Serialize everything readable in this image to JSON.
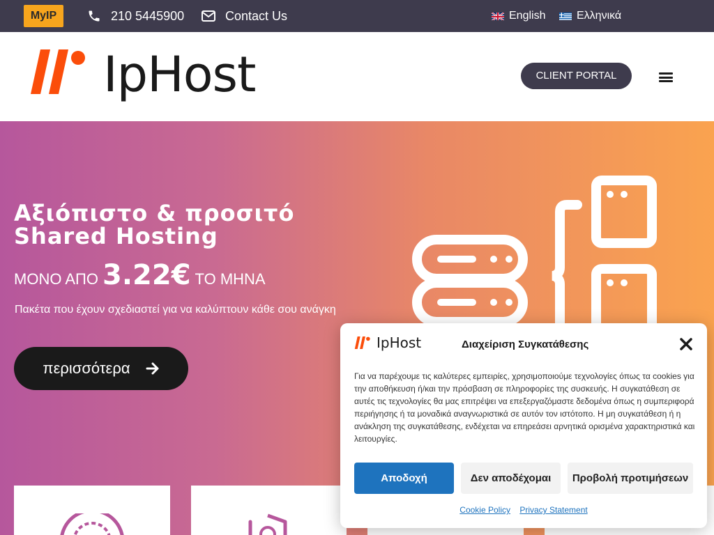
{
  "topbar": {
    "myip_label": "MyIP",
    "phone": "210 5445900",
    "contact": "Contact Us",
    "lang_en": "English",
    "lang_gr": "Ελληνικά"
  },
  "header": {
    "logo_text": "IpHost",
    "client_portal": "CLIENT PORTAL"
  },
  "hero": {
    "title_line1": "Αξιόπιστο & προσιτό",
    "title_line2": "Shared Hosting",
    "price_prefix": "ΜΟΝΟ ΑΠΟ",
    "price_value": "3.22€",
    "price_suffix": "ΤΟ ΜΗΝΑ",
    "subtitle": "Πακέτα που έχουν σχεδιαστεί για να καλύπτουν κάθε σου ανάγκη",
    "cta_label": "περισσότερα"
  },
  "consent": {
    "logo_text": "IpHost",
    "title": "Διαχείριση Συγκατάθεσης",
    "body": "Για να παρέχουμε τις καλύτερες εμπειρίες, χρησιμοποιούμε τεχνολογίες όπως τα cookies για την αποθήκευση ή/και την πρόσβαση σε πληροφορίες της συσκευής. Η συγκατάθεση σε αυτές τις τεχνολογίες θα μας επιτρέψει να επεξεργαζόμαστε δεδομένα όπως η συμπεριφορά περιήγησης ή τα μοναδικά αναγνωριστικά σε αυτόν τον ιστότοπο. Η μη συγκατάθεση ή η ανάκληση της συγκατάθεσης, ενδέχεται να επηρεάσει αρνητικά ορισμένα χαρακτηριστικά και λειτουργίες.",
    "accept": "Αποδοχή",
    "deny": "Δεν αποδέχομαι",
    "preferences": "Προβολή προτιμήσεων",
    "cookie_policy": "Cookie Policy",
    "privacy_statement": "Privacy Statement"
  },
  "colors": {
    "topbar_bg": "#3e3b4d",
    "myip_bg": "#f7a51d",
    "accept_bg": "#1e73be",
    "logo_orange": "#fb4d0a",
    "hero_gradient": [
      "#b6579c",
      "#faa34f"
    ]
  },
  "icons": [
    "phone-icon",
    "envelope-icon",
    "flag-uk-icon",
    "flag-greece-icon",
    "menu-icon",
    "arrow-right-icon",
    "close-icon",
    "server-illustration-icon"
  ]
}
